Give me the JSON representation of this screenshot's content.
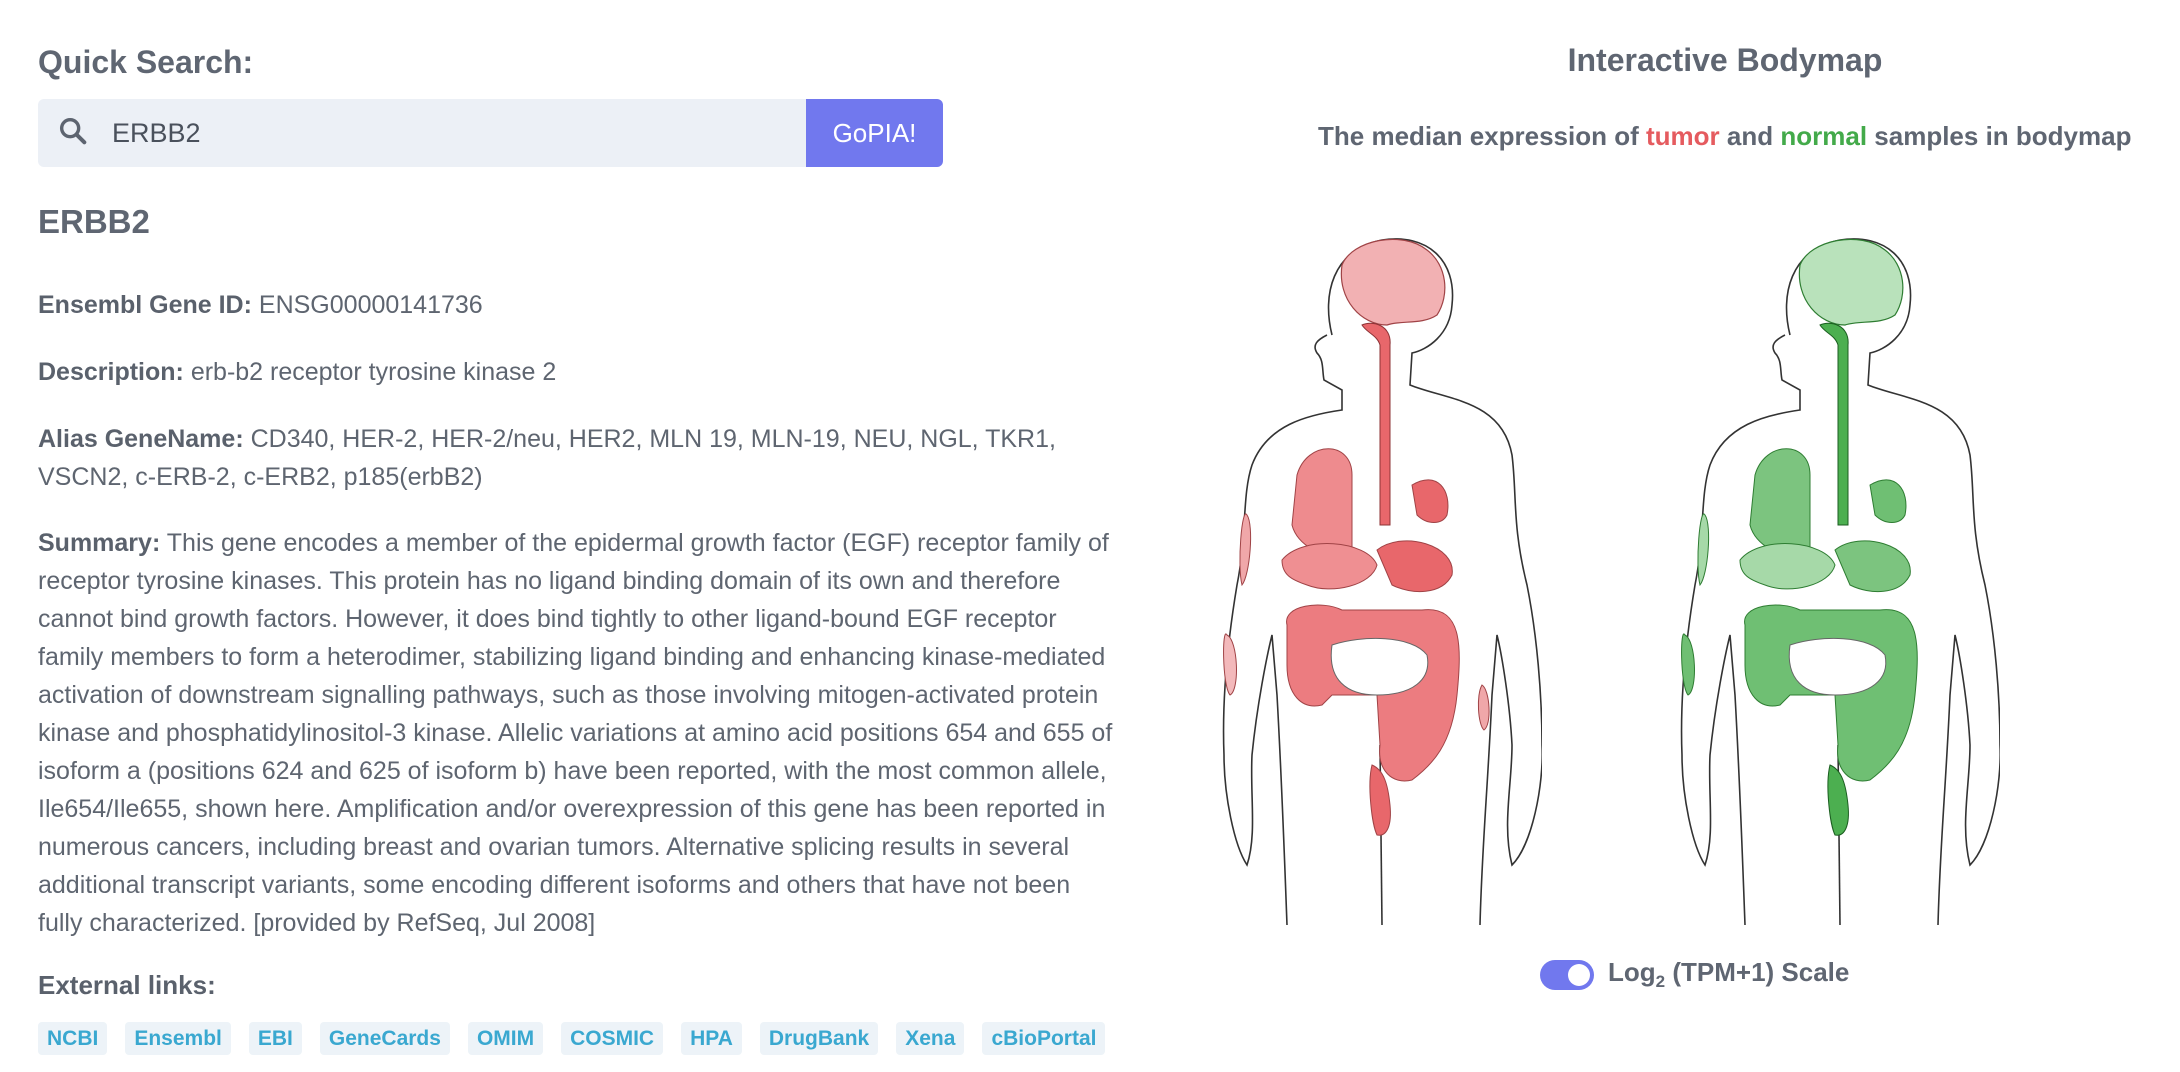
{
  "search": {
    "heading": "Quick Search:",
    "value": "ERBB2",
    "button_label": "GoPIA!"
  },
  "gene": {
    "symbol": "ERBB2",
    "ensembl_label": "Ensembl Gene ID:",
    "ensembl_id": "ENSG00000141736",
    "description_label": "Description:",
    "description": "erb-b2 receptor tyrosine kinase 2",
    "alias_label": "Alias GeneName:",
    "alias": "CD340, HER-2, HER-2/neu, HER2, MLN 19, MLN-19, NEU, NGL, TKR1, VSCN2, c-ERB-2, c-ERB2, p185(erbB2)",
    "summary_label": "Summary:",
    "summary": "This gene encodes a member of the epidermal growth factor (EGF) receptor family of receptor tyrosine kinases. This protein has no ligand binding domain of its own and therefore cannot bind growth factors. However, it does bind tightly to other ligand-bound EGF receptor family members to form a heterodimer, stabilizing ligand binding and enhancing kinase-mediated activation of downstream signalling pathways, such as those involving mitogen-activated protein kinase and phosphatidylinositol-3 kinase. Allelic variations at amino acid positions 654 and 655 of isoform a (positions 624 and 625 of isoform b) have been reported, with the most common allele, Ile654/Ile655, shown here. Amplification and/or overexpression of this gene has been reported in numerous cancers, including breast and ovarian tumors. Alternative splicing results in several additional transcript variants, some encoding different isoforms and others that have not been fully characterized. [provided by RefSeq, Jul 2008]"
  },
  "external": {
    "heading": "External links:",
    "links": [
      "NCBI",
      "Ensembl",
      "EBI",
      "GeneCards",
      "OMIM",
      "COSMIC",
      "HPA",
      "DrugBank",
      "Xena",
      "cBioPortal"
    ]
  },
  "bodymap": {
    "title": "Interactive Bodymap",
    "subtitle_pre": "The median expression of",
    "subtitle_tumor": "tumor",
    "subtitle_and": "and",
    "subtitle_normal": "normal",
    "subtitle_post": "samples in bodymap",
    "tumor_color": "#e8676b",
    "normal_color": "#4caf50",
    "scale_toggle_on": true,
    "scale_label_pre": "Log",
    "scale_label_sub": "2",
    "scale_label_post": " (TPM+1) Scale"
  }
}
